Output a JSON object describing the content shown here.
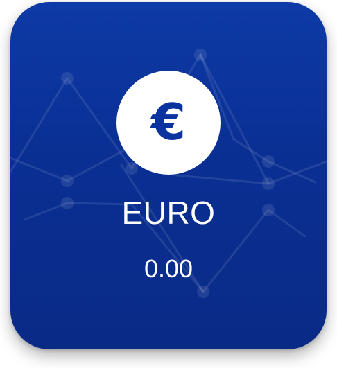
{
  "card": {
    "icon": "euro-sign-icon",
    "icon_glyph": "€",
    "name": "EURO",
    "value": "0.00",
    "colors": {
      "background_top": "#0d3aa6",
      "background_bottom": "#0a2a86",
      "icon_circle": "#ffffff",
      "icon_glyph": "#0b33a0",
      "text": "#ffffff"
    }
  }
}
